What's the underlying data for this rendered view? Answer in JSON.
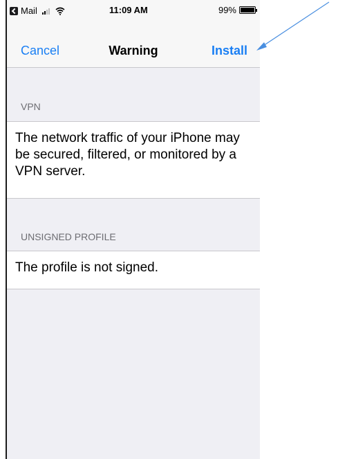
{
  "status_bar": {
    "back_app_label": "Mail",
    "time": "11:09 AM",
    "battery_percent": "99%",
    "battery_level": 0.99,
    "signal_bars_filled": 2,
    "signal_bars_total": 4,
    "icons": [
      "back-app-icon",
      "signal-icon",
      "wifi-icon",
      "battery-icon"
    ]
  },
  "nav": {
    "cancel_label": "Cancel",
    "title": "Warning",
    "install_label": "Install"
  },
  "sections": {
    "vpn": {
      "header": "VPN",
      "body": "The network traffic of your iPhone may be secured, filtered, or monitored by a VPN server."
    },
    "unsigned": {
      "header": "UNSIGNED PROFILE",
      "body": "The profile is not signed."
    }
  },
  "colors": {
    "accent": "#1a7ff4",
    "background": "#efeff4",
    "annotation_arrow": "#4a8fe0"
  }
}
